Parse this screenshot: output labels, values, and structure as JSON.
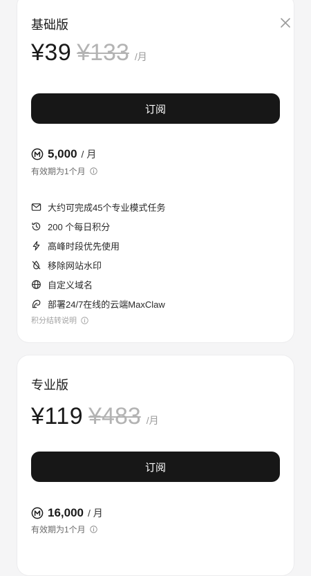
{
  "plans": [
    {
      "name": "基础版",
      "price": "¥39",
      "original_price": "¥133",
      "period": "/月",
      "subscribe_label": "订阅",
      "credits_amount": "5,000",
      "credits_unit": "/ 月",
      "validity": "有效期为1个月",
      "features": [
        {
          "icon": "mail-icon",
          "text": "大约可完成45个专业模式任务"
        },
        {
          "icon": "history-icon",
          "text": "200 个每日积分"
        },
        {
          "icon": "lightning-icon",
          "text": "高峰时段优先使用"
        },
        {
          "icon": "no-watermark-icon",
          "text": "移除网站水印"
        },
        {
          "icon": "globe-icon",
          "text": "自定义域名"
        },
        {
          "icon": "claw-icon",
          "text": "部署24/7在线的云端MaxClaw"
        }
      ],
      "credits_note": "积分结转说明"
    },
    {
      "name": "专业版",
      "price": "¥119",
      "original_price": "¥483",
      "period": "/月",
      "subscribe_label": "订阅",
      "credits_amount": "16,000",
      "credits_unit": "/ 月",
      "validity": "有效期为1个月"
    }
  ],
  "colors": {
    "button_bg": "#171717",
    "button_text": "#ffffff",
    "strike_price": "#b3b3b3",
    "muted_text": "#a3a3a3",
    "page_bg": "#f5f5f6"
  }
}
